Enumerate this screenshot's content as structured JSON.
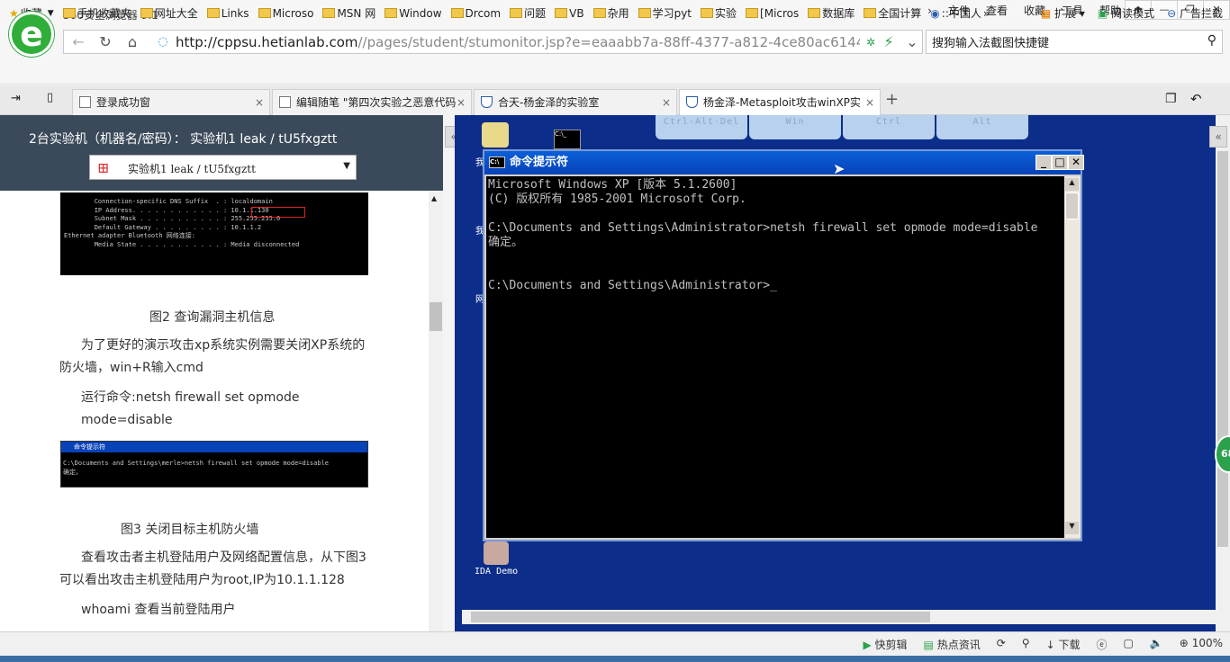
{
  "app": {
    "title": "360安全浏览器 9.1",
    "logo": "e"
  },
  "menus": [
    "文件",
    "查看",
    "收藏",
    "工具",
    "帮助"
  ],
  "window_buttons": [
    "🢁",
    "—",
    "❐",
    "✕"
  ],
  "address": {
    "host": "http://cppsu.hetianlab.com",
    "path": "//pages/student/stumonitor.jsp?e=eaaabb7a-88ff-4377-a812-4ce80ac6144e&",
    "icon": "lock-icon"
  },
  "search": {
    "value": "搜狗输入法截图快捷键",
    "icon": "search-icon"
  },
  "bookmarks": [
    "收藏",
    "手机收藏夹",
    "网址大全",
    "Links",
    "Microso",
    "MSN 网",
    "Window",
    "Drcom",
    "问题",
    "VB",
    "杂用",
    "学习pyt",
    "实验",
    "[Micros",
    "数据库",
    "全国计算",
    "::中国人"
  ],
  "bookmark_right": [
    "扩展",
    "阅读模式",
    "广告拦截"
  ],
  "tabs": [
    "登录成功窗",
    "编辑随笔 \"第四次实验之恶意代码",
    "合天-杨金泽的实验室",
    "杨金泽-Metasploit攻击winXP实"
  ],
  "left_panel": {
    "header": "2台实验机（机器名/密码）：  实验机1    leak / tU5fxgztt",
    "select_value": "实验机1    leak / tU5fxgztt",
    "fig2_lines": [
      "        Connection-specific DNS Suffix  . : localdomain",
      "        IP Address. . . . . . . . . . . . : 10.1.1.130",
      "        Subnet Mask . . . . . . . . . . . : 255.255.255.0",
      "        Default Gateway . . . . . . . . . : 10.1.1.2",
      "",
      "Ethernet adapter Bluetooth 网络连接:",
      "",
      "        Media State . . . . . . . . . . . : Media disconnected"
    ],
    "fig2_caption": "图2 查询漏洞主机信息",
    "para1": "为了更好的演示攻击xp系统实例需要关闭XP系统的防火墙，win+R输入cmd",
    "para2": "运行命令:netsh firewall set opmode mode=disable",
    "fig3_title": "命令提示符",
    "fig3_lines": [
      "C:\\Documents and Settings\\merle>netsh firewall set opmode mode=disable",
      "确定。"
    ],
    "fig3_caption": "图3 关闭目标主机防火墙",
    "para3": "查看攻击者主机登陆用户及网络配置信息，从下图3可以看出攻击主机登陆用户为root,IP为10.1.1.128",
    "para4": "whoami  查看当前登陆用户"
  },
  "remote": {
    "toolbar": [
      "Ctrl-Alt-Del",
      "Win",
      "Ctrl",
      "Alt"
    ],
    "desktop_icons": [
      "我",
      "我",
      "网",
      "IDA Demo"
    ],
    "cmd_title": "命令提示符",
    "cmd_lines": [
      "Microsoft Windows XP [版本 5.1.2600]",
      "(C) 版权所有 1985-2001 Microsoft Corp.",
      "",
      "C:\\Documents and Settings\\Administrator>netsh firewall set opmode mode=disable",
      "确定。",
      "",
      "",
      "C:\\Documents and Settings\\Administrator>_"
    ],
    "badge": "68"
  },
  "status": [
    "快剪辑",
    "热点资讯",
    "下载",
    "100%"
  ]
}
